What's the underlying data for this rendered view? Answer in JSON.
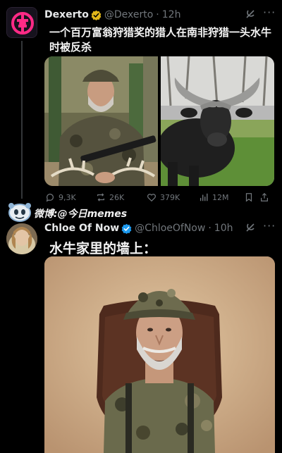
{
  "tweet1": {
    "author": {
      "name": "Dexerto",
      "handle": "@Dexerto",
      "time": "12h",
      "verified": "gold-check"
    },
    "text": "一个百万富翁狩猎奖的猎人在南非狩猎一头水牛时被反杀",
    "media": [
      "hunter-with-rifle-photo",
      "cape-buffalo-photo"
    ],
    "stats": {
      "replies": "9,3K",
      "reposts": "26K",
      "likes": "379K",
      "views": "12M"
    }
  },
  "watermark": {
    "text": "微博:@今日memes"
  },
  "tweet2": {
    "author": {
      "name": "Chloe Of Now",
      "handle": "@ChloeOfNow",
      "time": "10h",
      "verified": "blue-check"
    },
    "text": "水牛家里的墙上：",
    "media": "hunter-head-trophy-mount-photo"
  },
  "colors": {
    "background": "#000000",
    "text": "#e7e9ea",
    "muted": "#71767b",
    "gold_badge": "#e2b719",
    "blue_badge": "#1d9bf0"
  }
}
